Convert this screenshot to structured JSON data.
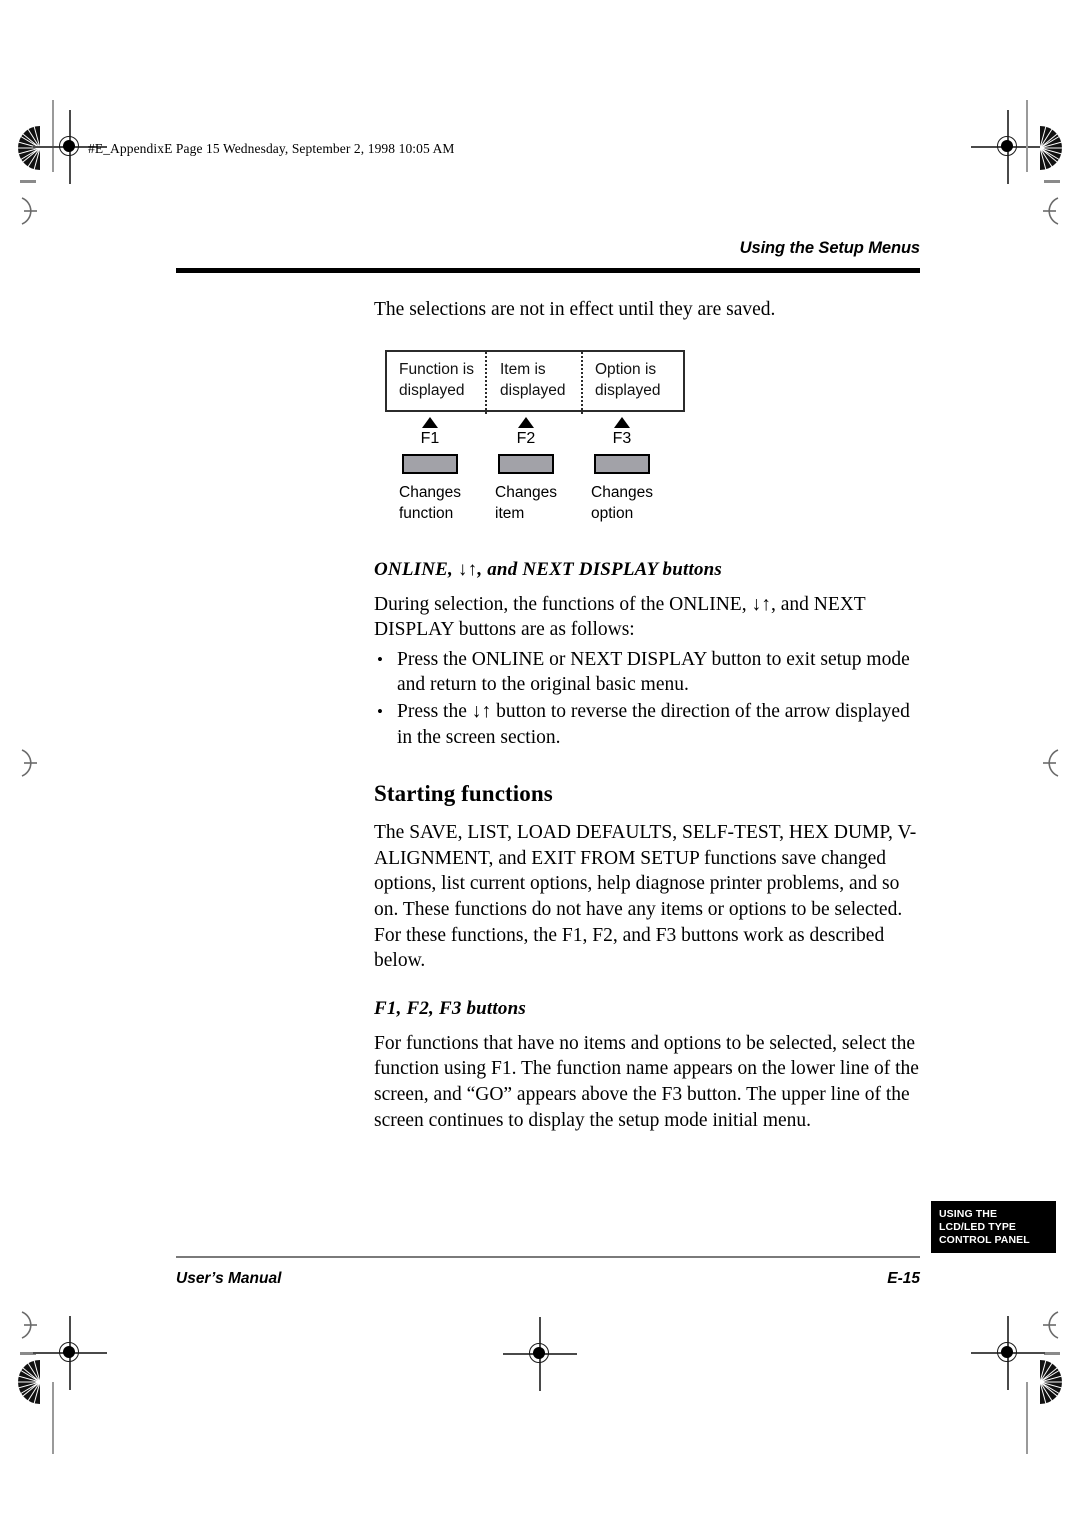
{
  "page": {
    "filestamp": "#E_AppendixE  Page 15  Wednesday, September 2, 1998  10:05 AM",
    "running_head": "Using the Setup Menus",
    "footer_left": "User’s Manual",
    "footer_right": "E-15"
  },
  "thumb_tab": {
    "line1": "USING THE",
    "line2": "LCD/LED TYPE",
    "line3": "CONTROL PANEL"
  },
  "content": {
    "intro": "The selections are not in effect until they are saved.",
    "section1": {
      "heading": "ONLINE, ↓↑, and NEXT DISPLAY buttons",
      "paragraph": "During selection, the functions of the ONLINE, ↓↑, and NEXT DISPLAY buttons are as follows:",
      "bullets": [
        "Press the ONLINE or NEXT DISPLAY button to exit setup mode and return to the original basic menu.",
        "Press the ↓↑ button to reverse the direction of the arrow displayed in the screen section."
      ]
    },
    "section2": {
      "heading": "Starting functions",
      "paragraph": "The SAVE, LIST, LOAD DEFAULTS, SELF-TEST, HEX DUMP, V-ALIGNMENT, and EXIT FROM SETUP functions save changed options, list current options, help diagnose printer problems, and so on. These functions do not have any items or options to be selected. For these functions, the F1, F2, and F3 buttons work as described below."
    },
    "section3": {
      "heading": "F1, F2, F3 buttons",
      "paragraph": "For functions that have no items and options to be selected, select the function using F1. The function name appears on the lower line of the screen, and “GO” appears above the F3 button. The upper line of the screen continues to display the setup mode initial menu."
    }
  },
  "figure": {
    "screen_cells": [
      {
        "line1": "Function is",
        "line2": "displayed"
      },
      {
        "line1": "Item is",
        "line2": "displayed"
      },
      {
        "line1": "Option is",
        "line2": "displayed"
      }
    ],
    "buttons": [
      {
        "label": "F1",
        "caption_line1": "Changes",
        "caption_line2": "function"
      },
      {
        "label": "F2",
        "caption_line1": "Changes",
        "caption_line2": "item"
      },
      {
        "label": "F3",
        "caption_line1": "Changes",
        "caption_line2": "option"
      }
    ],
    "button_fill_color": "#a2a2a8",
    "arrow_glyph": "up-triangle"
  }
}
